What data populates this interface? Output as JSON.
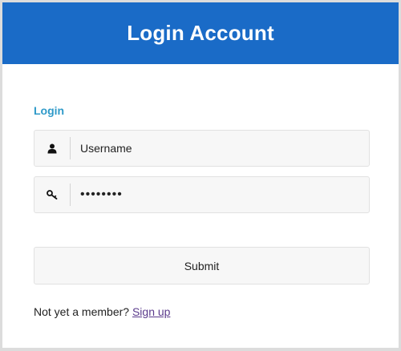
{
  "header": {
    "title": "Login Account"
  },
  "form": {
    "section_label": "Login",
    "username": {
      "placeholder": "Username",
      "icon": "user-icon"
    },
    "password": {
      "value": "passwd12",
      "icon": "key-icon"
    },
    "submit_label": "Submit"
  },
  "footer": {
    "prompt": "Not yet a member?",
    "signup_link": "Sign up"
  },
  "colors": {
    "header_bg": "#1a6bc7",
    "section_label": "#2f9ac9",
    "link": "#5b3b8c"
  }
}
